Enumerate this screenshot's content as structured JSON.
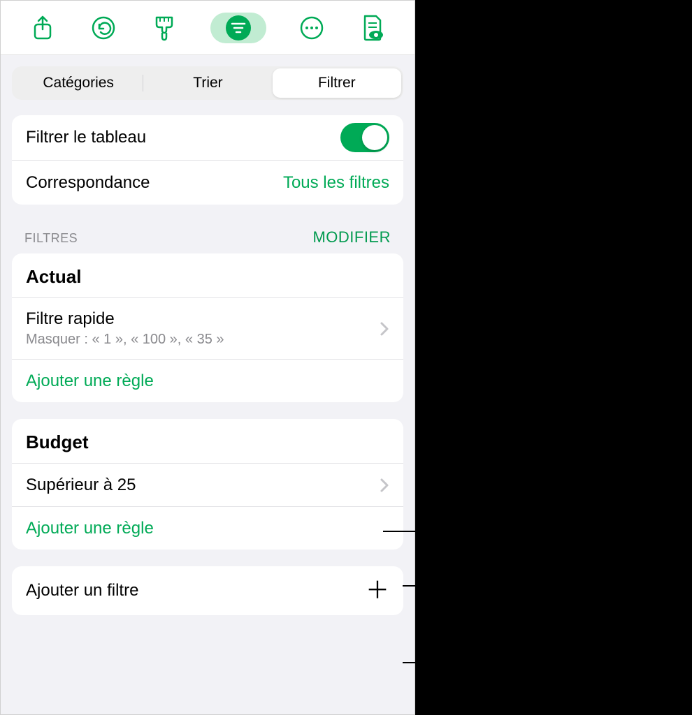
{
  "toolbar": {
    "icons": [
      "share",
      "undo",
      "brush",
      "filter",
      "more",
      "preview"
    ]
  },
  "segmented": {
    "items": [
      "Catégories",
      "Trier",
      "Filtrer"
    ],
    "activeIndex": 2
  },
  "filterSwitch": {
    "label": "Filtrer le tableau",
    "on": true
  },
  "match": {
    "label": "Correspondance",
    "value": "Tous les filtres"
  },
  "filtersHeader": {
    "title": "FILTRES",
    "action": "MODIFIER"
  },
  "groups": [
    {
      "name": "Actual",
      "rules": [
        {
          "title": "Filtre rapide",
          "subtitle": "Masquer : « 1 », « 100 », « 35 »"
        }
      ],
      "addLabel": "Ajouter une règle"
    },
    {
      "name": "Budget",
      "rules": [
        {
          "title": "Supérieur à 25"
        }
      ],
      "addLabel": "Ajouter une règle"
    }
  ],
  "addFilterLabel": "Ajouter un filtre"
}
